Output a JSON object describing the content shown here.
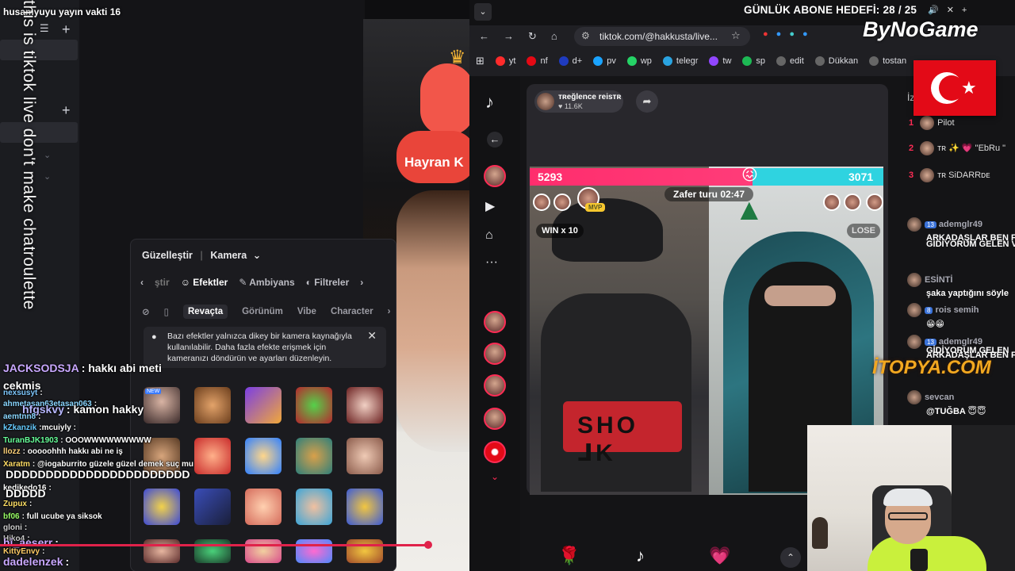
{
  "stream": {
    "title": "husamyuyu yayın vakti 16",
    "vertical_note": "this is tiktok live don't make chatroulette"
  },
  "camera_panel": {
    "beautify": "Güzelleştir",
    "camera": "Kamera",
    "tabs": [
      "ştir",
      "Efektler",
      "Ambiyans",
      "Filtreler"
    ],
    "active_tab": "Efektler",
    "subtabs": [
      "Revaçta",
      "Görünüm",
      "Vibe",
      "Character"
    ],
    "active_subtab": "Revaçta",
    "notice": "Bazı efektler yalnızca dikey bir kamera kaynağıyla kullanılabilir. Daha fazla efekte erişmek için kameranızı döndürün ve ayarları düzenleyin.",
    "effect_badge": "NEW"
  },
  "overlay_badge": "Hayran K",
  "chat": {
    "messages": [
      {
        "user": "JACKSODSJA",
        "text": ": hakkı abi meti",
        "color": "#c9a8ff",
        "big": true
      },
      {
        "user": "cekmis",
        "text": "",
        "color": "#ffffff",
        "big": true
      },
      {
        "user": "nexsusyt",
        "text": ":",
        "color": "#7ec8ff",
        "big": false
      },
      {
        "user": "ahmetasan63etasan063",
        "text": ":",
        "color": "#8ad6ff",
        "big": false
      },
      {
        "user": "hfgskvy",
        "text": ": kamon hakky",
        "color": "#b8b8ff",
        "big": true
      },
      {
        "user": "aemtnn8",
        "text": ":",
        "color": "#8ad6ff",
        "big": false
      },
      {
        "user": "kZkanzik",
        "text": ":mcuiyly :",
        "color": "#66ccff",
        "big": false
      },
      {
        "user": "TuranBJK1903",
        "text": ": OOOWWWWWWWWW",
        "color": "#66ff99",
        "big": false
      },
      {
        "user": "llozz",
        "text": ": ooooohhh hakkı abi ne iş",
        "color": "#ffd27a",
        "big": false
      },
      {
        "user": "Xaratm",
        "text": ": @iogaburrito güzele güzel demek suç mu",
        "color": "#ffdd66",
        "big": false
      },
      {
        "user": "",
        "text": "DDDDDDDDDDDDDDDDDDDDDDD",
        "color": "#ffffff",
        "big": true
      },
      {
        "user": "kedikedo16",
        "text": ":",
        "color": "#ffffff",
        "big": false
      },
      {
        "user": "",
        "text": "DDDDD",
        "color": "#ffffff",
        "big": true
      },
      {
        "user": "Zupux",
        "text": ":",
        "color": "#ffe066",
        "big": false
      },
      {
        "user": "bf06",
        "text": ": full ucube ya siksok",
        "color": "#99ff66",
        "big": false
      },
      {
        "user": "gloni",
        "text": ":",
        "color": "#cccccc",
        "big": false
      },
      {
        "user": "Hiko4",
        "text": ":",
        "color": "#cccccc",
        "big": false
      },
      {
        "user": "hi_aeserr",
        "text": ":",
        "color": "#c9a8ff",
        "big": true
      },
      {
        "user": "KittyEnvy",
        "text": ":",
        "color": "#ffcc66",
        "big": false
      },
      {
        "user": "dadelenzek",
        "text": ":",
        "color": "#c9a8ff",
        "big": true
      }
    ]
  },
  "browser": {
    "goal_title": "GÜNLÜK ABONE HEDEFİ: 28 / 25",
    "url": "tiktok.com/@hakkusta/live...",
    "bookmarks": [
      {
        "label": "yt",
        "color": "#ff2b2b"
      },
      {
        "label": "nf",
        "color": "#e50914"
      },
      {
        "label": "d+",
        "color": "#1f3bbf"
      },
      {
        "label": "pv",
        "color": "#1aa3ff"
      },
      {
        "label": "wp",
        "color": "#25d366"
      },
      {
        "label": "telegr",
        "color": "#2aa3e0"
      },
      {
        "label": "tw",
        "color": "#9146ff"
      },
      {
        "label": "sp",
        "color": "#1db954"
      },
      {
        "label": "edit",
        "color": "#666666"
      },
      {
        "label": "Dükkan",
        "color": "#666666"
      },
      {
        "label": "tostan",
        "color": "#666666"
      }
    ]
  },
  "live": {
    "host_name": "ᴛʀeğlence reisᴛʀ",
    "host_likes": "♥ 11.6K",
    "score_left": "5293",
    "score_right": "3071",
    "score_share": 0.63,
    "timer": "Zafer turu 02:47",
    "win_label": "WIN x 10",
    "lose_label": "LOSE",
    "mvp": "MVP",
    "shirt_text": "SHO  ⅃K"
  },
  "tt_chat": {
    "header": "İz",
    "ranking": [
      {
        "n": "1",
        "name": "Pilot"
      },
      {
        "n": "2",
        "name": "ᴛʀ ✨ 💗 \"EbRu \""
      },
      {
        "n": "3",
        "name": "ᴛʀ SiDARRᴅᴇ"
      }
    ],
    "comments": [
      {
        "user": "ademglr49",
        "level": "13",
        "text": "ARKADAŞLAR BEN F"
      },
      {
        "user": "",
        "level": "",
        "text": "GİDİYORUM GELEN V"
      },
      {
        "user": "ESİNTİ",
        "level": "",
        "text": "şaka yaptığını söyle"
      },
      {
        "user": "rois semih",
        "level": "8",
        "text": "😁😁"
      },
      {
        "user": "ademglr49",
        "level": "13",
        "text": "ARKADAŞLAR BEN F"
      },
      {
        "user": "",
        "level": "",
        "text": "GİDİYORUM GELEN"
      },
      {
        "user": "sevcan",
        "level": "",
        "text": "@TUĞBA 😇😇"
      }
    ]
  },
  "branding": {
    "bynogame": "ByNoGame",
    "itopya": "İTOPYA.COM"
  }
}
